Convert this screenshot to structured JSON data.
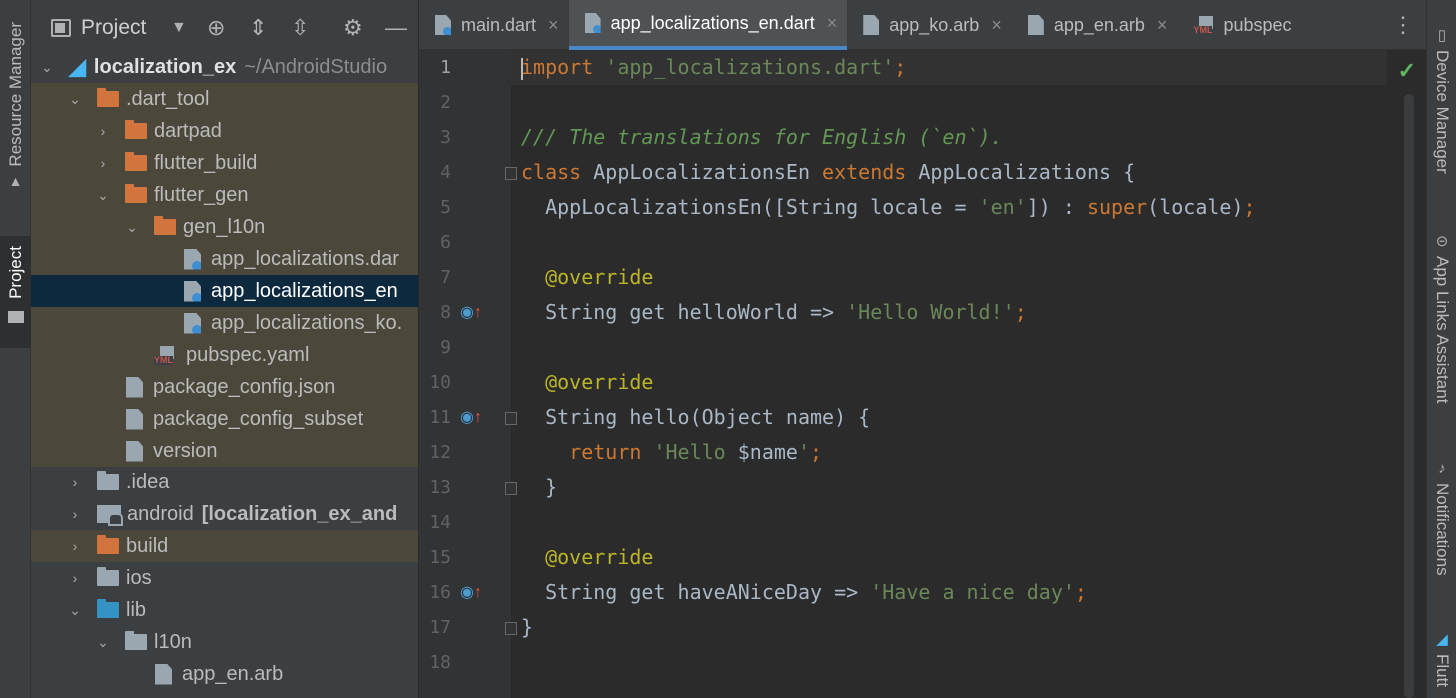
{
  "left_stripe": {
    "resource_manager": "Resource Manager",
    "project": "Project"
  },
  "project_panel": {
    "title": "Project",
    "rows": [
      {
        "label": "localization_ex",
        "path": "~/AndroidStudio"
      },
      {
        "label": ".dart_tool"
      },
      {
        "label": "dartpad"
      },
      {
        "label": "flutter_build"
      },
      {
        "label": "flutter_gen"
      },
      {
        "label": "gen_l10n"
      },
      {
        "label": "app_localizations.dar"
      },
      {
        "label": "app_localizations_en"
      },
      {
        "label": "app_localizations_ko."
      },
      {
        "label": "pubspec.yaml"
      },
      {
        "label": "package_config.json"
      },
      {
        "label": "package_config_subset"
      },
      {
        "label": "version"
      },
      {
        "label": ".idea"
      },
      {
        "label": "android",
        "extra": "[localization_ex_and"
      },
      {
        "label": "build"
      },
      {
        "label": "ios"
      },
      {
        "label": "lib"
      },
      {
        "label": "l10n"
      },
      {
        "label": "app_en.arb"
      }
    ]
  },
  "tabs": [
    {
      "label": "main.dart"
    },
    {
      "label": "app_localizations_en.dart"
    },
    {
      "label": "app_ko.arb"
    },
    {
      "label": "app_en.arb"
    },
    {
      "label": "pubspec"
    }
  ],
  "icons": {
    "yml_badge": "YML",
    "close": "×",
    "more": "⋮",
    "check": "✓"
  },
  "line_numbers": [
    "1",
    "2",
    "3",
    "4",
    "5",
    "6",
    "7",
    "8",
    "9",
    "10",
    "11",
    "12",
    "13",
    "14",
    "15",
    "16",
    "17",
    "18"
  ],
  "code": {
    "l1_kw": "import",
    "l1_str": " 'app_localizations.dart'",
    "l1_end": ";",
    "l3": "/// The translations for English (`en`).",
    "l4_kw1": "class",
    "l4_a": " AppLocalizationsEn ",
    "l4_kw2": "extends",
    "l4_b": " AppLocalizations {",
    "l5_a": "  AppLocalizationsEn([String locale = ",
    "l5_str": "'en'",
    "l5_b": "]) : ",
    "l5_kw": "super",
    "l5_c": "(locale)",
    "l5_end": ";",
    "l7": "  @override",
    "l8_a": "  String get helloWorld => ",
    "l8_str": "'Hello World!'",
    "l8_end": ";",
    "l10": "  @override",
    "l11": "  String hello(Object name) {",
    "l12_kw": "    return",
    "l12_s1": " 'Hello ",
    "l12_var": "$name",
    "l12_s2": "'",
    "l12_end": ";",
    "l13": "  }",
    "l15": "  @override",
    "l16_a": "  String get haveANiceDay => ",
    "l16_str": "'Have a nice day'",
    "l16_end": ";",
    "l17": "}"
  },
  "right_stripe": {
    "device_manager": "Device Manager",
    "app_links": "App Links Assistant",
    "notifications": "Notifications",
    "flutter": "Flutt"
  }
}
